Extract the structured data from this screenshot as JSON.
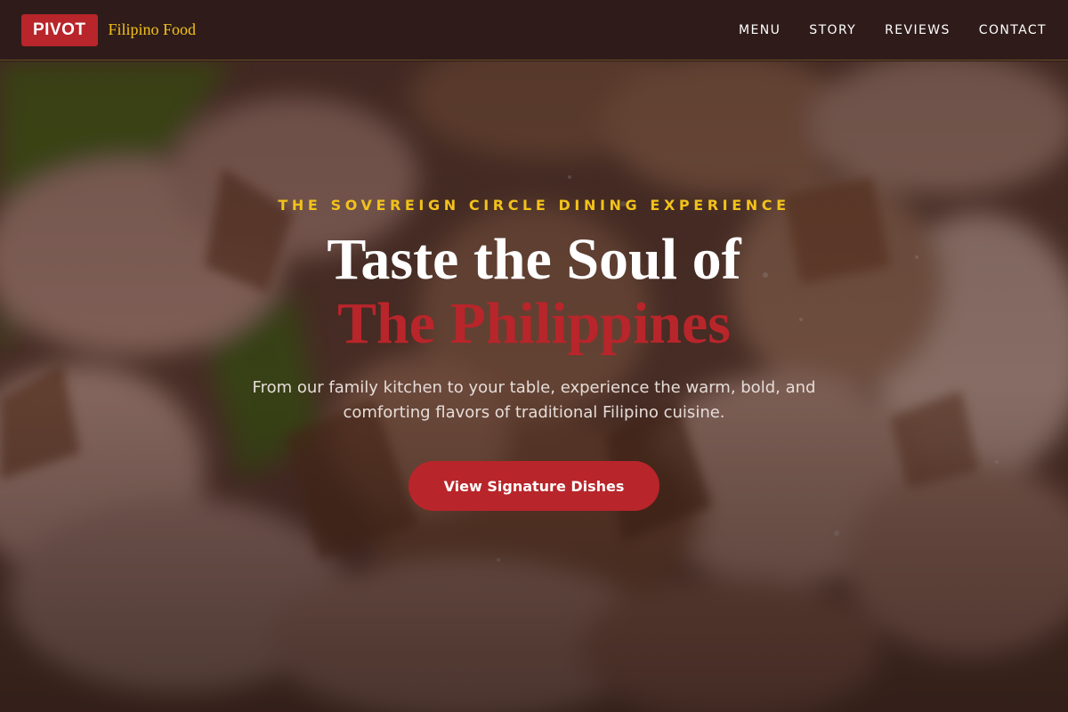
{
  "navbar": {
    "logo": "PIVOT",
    "tagline": "Filipino Food",
    "links": [
      "MENU",
      "STORY",
      "REVIEWS",
      "CONTACT"
    ]
  },
  "hero": {
    "eyebrow": "THE SOVEREIGN CIRCLE DINING EXPERIENCE",
    "headline_line1": "Taste the Soul of",
    "headline_line2": "The Philippines",
    "subtext": "From our family kitchen to your table, experience the warm, bold, and comforting flavors of traditional Filipino cuisine.",
    "cta_label": "View Signature Dishes"
  },
  "colors": {
    "brand_red": "#b8252a",
    "accent_gold": "#f2c21b",
    "nav_bg": "#2f1c1a"
  }
}
